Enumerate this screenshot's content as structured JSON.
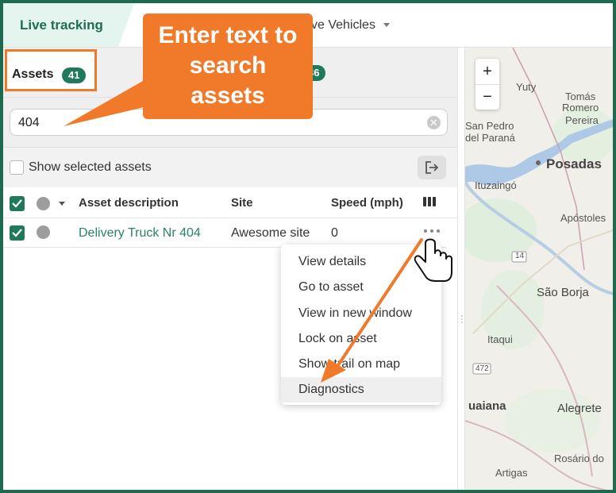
{
  "topbar": {
    "tab_live": "Live tracking",
    "tab_vehicles": "ve Vehicles"
  },
  "assets_tab": {
    "label": "Assets",
    "count": "41",
    "other_count": "36"
  },
  "search": {
    "value": "404",
    "clear_icon": "clear-icon"
  },
  "options": {
    "show_selected_label": "Show selected assets",
    "export_icon": "export-icon"
  },
  "table": {
    "headers": [
      "Asset description",
      "Site",
      "Speed (mph)"
    ],
    "rows": [
      {
        "description": "Delivery Truck Nr 404",
        "site": "Awesome site",
        "speed": "0",
        "checked": true
      }
    ]
  },
  "context_menu": {
    "items": [
      "View details",
      "Go to asset",
      "View in new window",
      "Lock on asset",
      "Show trail on map",
      "Diagnostics"
    ],
    "highlighted": "Diagnostics"
  },
  "map": {
    "zoom_in": "+",
    "zoom_out": "−",
    "labels": [
      "Yuty",
      "Tomás",
      "Romero",
      "Pereira",
      "San Pedro",
      "del Paraná",
      "Posadas",
      "Ituzaingó",
      "Apóstoles",
      "14",
      "São Borja",
      "Itaqui",
      "472",
      "uaiana",
      "Alegrete",
      "Rosário do",
      "Artigas"
    ]
  },
  "annotation": {
    "callout_lines": [
      "Enter text to",
      "search",
      "assets"
    ],
    "accent_color": "#f07a2a",
    "brand_color": "#1f7a5b"
  }
}
